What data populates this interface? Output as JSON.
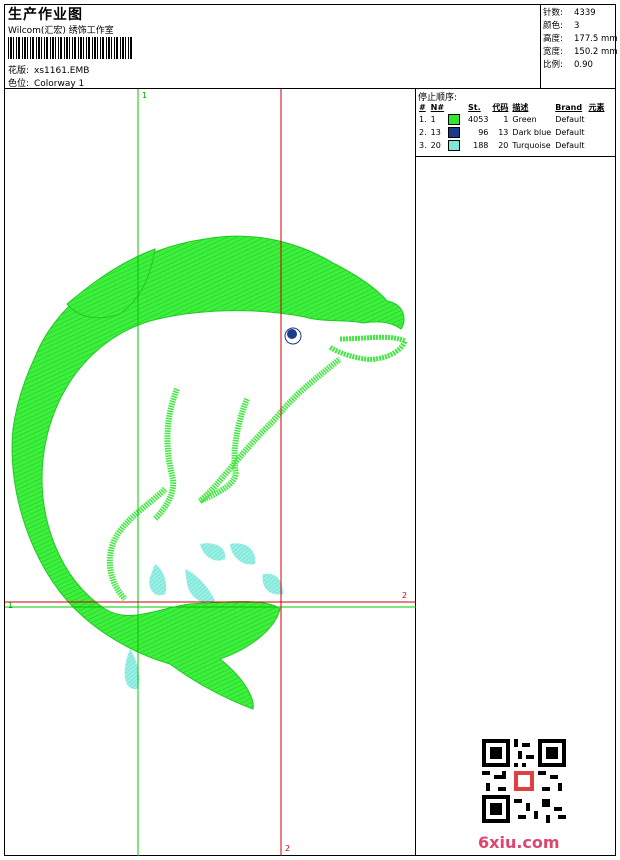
{
  "header": {
    "title": "生产作业图",
    "company": "Wilcom(汇宏) 绣饰工作室",
    "design_label": "花版:",
    "design_value": "xs1161.EMB",
    "colorway_label": "色位:",
    "colorway_value": "Colorway 1"
  },
  "stats": [
    {
      "label": "针数:",
      "value": "4339"
    },
    {
      "label": "颜色:",
      "value": "3"
    },
    {
      "label": "高度:",
      "value": "177.5 mm"
    },
    {
      "label": "宽度:",
      "value": "150.2 mm"
    },
    {
      "label": "比例:",
      "value": "0.90"
    }
  ],
  "stop_sequence": {
    "title": "停止顺序:",
    "columns": [
      "#",
      "N#",
      "St.",
      "代码",
      "描述",
      "Brand",
      "元素"
    ],
    "rows": [
      {
        "idx": "1.",
        "n": "1",
        "st": "4053",
        "code": "1",
        "desc": "Green",
        "brand": "Default",
        "color": "#2ee82e"
      },
      {
        "idx": "2.",
        "n": "13",
        "st": "96",
        "code": "13",
        "desc": "Dark blue",
        "brand": "Default",
        "color": "#1a3a8c"
      },
      {
        "idx": "3.",
        "n": "20",
        "st": "188",
        "code": "20",
        "desc": "Turquoise",
        "brand": "Default",
        "color": "#7ee8d8"
      }
    ]
  },
  "guides": {
    "top_1": "1",
    "left_1": "1",
    "right_2": "2",
    "bottom_2": "2"
  },
  "watermark": {
    "brand": "6xiu.com"
  },
  "colors": {
    "green": "#2ee82e",
    "dark_blue": "#1a3a8c",
    "turquoise": "#7ee8d8",
    "guide_green": "#00c800",
    "guide_red": "#d00000"
  }
}
